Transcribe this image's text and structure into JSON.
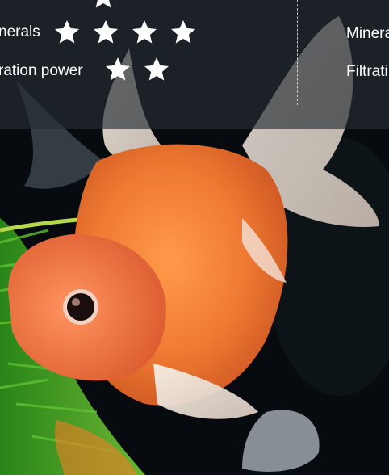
{
  "comparison": {
    "left": {
      "rows": [
        {
          "label": "nerals",
          "rating": 4
        },
        {
          "label": "ration power",
          "rating": 2
        }
      ]
    },
    "right": {
      "rows": [
        {
          "label": "Minera"
        },
        {
          "label": "Filtrati"
        }
      ]
    }
  },
  "colors": {
    "star": "#ffffff",
    "overlay": "#2a3036"
  },
  "icons": {
    "rating": "star-icon"
  }
}
